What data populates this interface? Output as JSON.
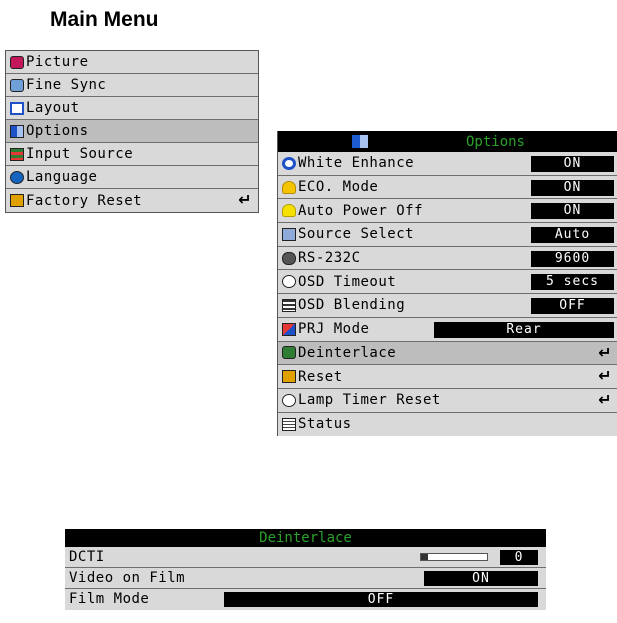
{
  "title": "Main Menu",
  "main_menu": {
    "items": [
      {
        "label": "Picture",
        "icon": "picture-icon",
        "color": "#c2185b"
      },
      {
        "label": "Fine Sync",
        "icon": "fine-sync-icon",
        "color": "#6fa0d8"
      },
      {
        "label": "Layout",
        "icon": "layout-icon",
        "color": "#1e50c8"
      },
      {
        "label": "Options",
        "icon": "options-icon",
        "color": "#1e50c8",
        "selected": true
      },
      {
        "label": "Input Source",
        "icon": "input-source-icon",
        "color": "#2e7d32"
      },
      {
        "label": "Language",
        "icon": "language-globe-icon",
        "color": "#1565c0"
      },
      {
        "label": "Factory Reset",
        "icon": "factory-reset-folder-icon",
        "color": "#e0a000",
        "enter": "↵"
      }
    ]
  },
  "options": {
    "header": "Options",
    "items": [
      {
        "label": "White Enhance",
        "icon": "white-enhance-icon",
        "value": "ON"
      },
      {
        "label": "ECO. Mode",
        "icon": "eco-mode-bulb-icon",
        "value": "ON"
      },
      {
        "label": "Auto Power Off",
        "icon": "auto-power-off-bulb-icon",
        "value": "ON"
      },
      {
        "label": "Source Select",
        "icon": "source-select-icon",
        "value": "Auto"
      },
      {
        "label": "RS-232C",
        "icon": "rs232c-connector-icon",
        "value": "9600"
      },
      {
        "label": "OSD Timeout",
        "icon": "osd-timeout-clock-icon",
        "value": "5 secs"
      },
      {
        "label": "OSD Blending",
        "icon": "osd-blending-icon",
        "value": "OFF"
      },
      {
        "label": "PRJ Mode",
        "icon": "prj-mode-icon",
        "value": "Rear"
      },
      {
        "label": "Deinterlace",
        "icon": "deinterlace-icon",
        "enter": "↵"
      },
      {
        "label": "Reset",
        "icon": "reset-folder-icon",
        "enter": "↵"
      },
      {
        "label": "Lamp Timer Reset",
        "icon": "lamp-timer-clock-icon",
        "enter": "↵"
      },
      {
        "label": "Status",
        "icon": "status-document-icon"
      }
    ]
  },
  "deinterlace": {
    "header": "Deinterlace",
    "dcti_label": "DCTI",
    "dcti_value": "0",
    "dcti_level": 0.1,
    "video_on_film_label": "Video on Film",
    "video_on_film_value": "ON",
    "film_mode_label": "Film Mode",
    "film_mode_value": "OFF"
  }
}
